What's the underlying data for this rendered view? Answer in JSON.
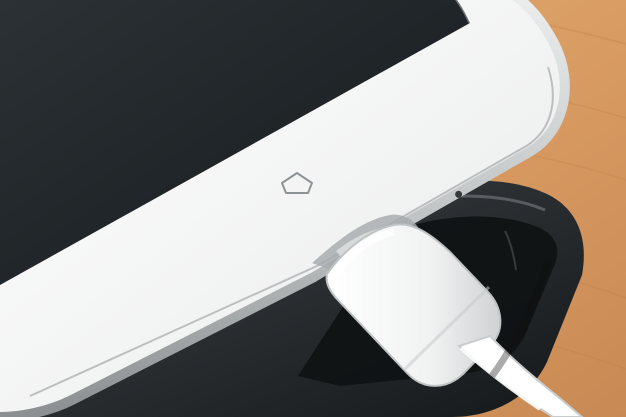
{
  "scene": {
    "subject": "white-smartphone-charging",
    "objects": [
      "white-smartphone",
      "usb-charging-cable",
      "black-smartphone",
      "wooden-table"
    ],
    "colors": {
      "wood": "#d9a66f",
      "screen": "#1e2326",
      "phone_body": "#f5f6f6",
      "phone_trim": "#c9cccd",
      "cable": "#f3f4f4",
      "dark_phone": "#262a2d"
    },
    "icons": {
      "home_button": "house-icon"
    }
  }
}
